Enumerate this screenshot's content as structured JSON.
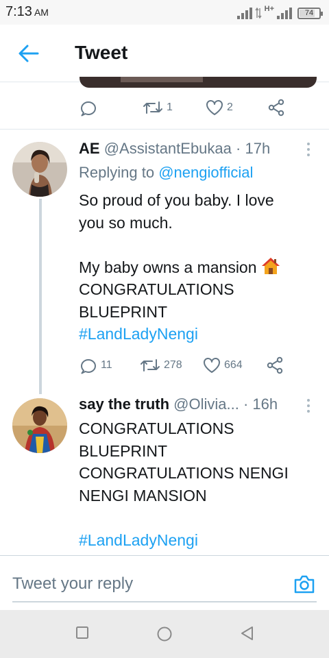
{
  "status_bar": {
    "time": "7:13",
    "ampm": "AM",
    "network": "H+",
    "battery": "74"
  },
  "header": {
    "title": "Tweet",
    "back_icon": "arrow-left-icon"
  },
  "top_tweet": {
    "retweets": "1",
    "likes": "2"
  },
  "tweets": [
    {
      "name": "AE",
      "handle": "@AssistantEbukaa",
      "dot": "·",
      "time": "17h",
      "replying_label": "Replying to",
      "replying_to": "@nengiofficial",
      "lines": [
        "So proud of you baby. I love",
        "you so much.",
        "",
        "My baby owns a mansion",
        "CONGRATULATIONS",
        "BLUEPRINT"
      ],
      "hashtag": "#LandLadyNengi",
      "replies": "11",
      "retweets": "278",
      "likes": "664"
    },
    {
      "name": "say the truth",
      "handle": "@Olivia...",
      "dot": "·",
      "time": "16h",
      "lines": [
        "CONGRATULATIONS",
        "BLUEPRINT",
        "CONGRATULATIONS NENGI",
        "NENGI MANSION",
        ""
      ],
      "hashtag": "#LandLadyNengi"
    }
  ],
  "reply_box": {
    "placeholder": "Tweet your reply",
    "camera_icon": "camera-icon"
  },
  "colors": {
    "accent": "#1da1f2",
    "secondary_text": "#657786",
    "divider": "#e1e8ed"
  }
}
